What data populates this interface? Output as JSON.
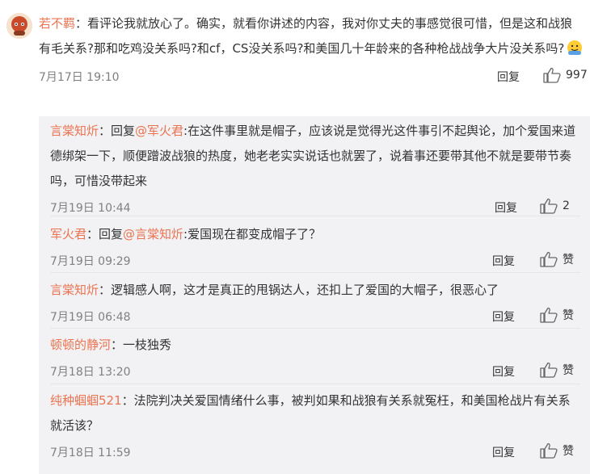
{
  "main": {
    "username": "若不羁",
    "text": "：看评论我就放心了。确实，就看你讲述的内容，我对你丈夫的事感觉很可惜，但是这和战狼有毛关系?那和吃鸡没关系吗?和cf，CS没关系吗?和美国几十年龄来的各种枪战战争大片没关系吗?",
    "time": "7月17日 19:10",
    "reply_label": "回复",
    "likes": "997"
  },
  "replies": [
    {
      "username": "言棠知炘",
      "reply_prefix": "：回复",
      "mention": "@军火君",
      "text": ":在这件事里就是帽子，应该说是觉得光这件事引不起舆论，加个爱国来道德绑架一下，顺便蹭波战狼的热度，她老老实实说话也就罢了，说着事还要带其他不就是要带节奏吗，可惜没带起来",
      "time": "7月19日 10:44",
      "reply_label": "回复",
      "likes": "2"
    },
    {
      "username": "军火君",
      "reply_prefix": "：回复",
      "mention": "@言棠知炘",
      "text": ":爱国现在都变成帽子了？",
      "time": "7月19日 09:29",
      "reply_label": "回复",
      "likes": "赞"
    },
    {
      "username": "言棠知炘",
      "reply_prefix": "",
      "mention": "",
      "text": "：逻辑感人啊，这才是真正的甩锅达人，还扣上了爱国的大帽子，很恶心了",
      "time": "7月19日 06:48",
      "reply_label": "回复",
      "likes": "赞"
    },
    {
      "username": "顿顿的静河",
      "reply_prefix": "",
      "mention": "",
      "text": "：一枝独秀",
      "time": "7月18日 13:20",
      "reply_label": "回复",
      "likes": "赞"
    },
    {
      "username": "纯种蝈蝈521",
      "reply_prefix": "",
      "mention": "",
      "text": "：法院判决关爱国情绪什么事，被判如果和战狼有关系就冤枉，和美国枪战片有关系就活该？",
      "time": "7月18日 11:59",
      "reply_label": "回复",
      "likes": "赞"
    }
  ]
}
